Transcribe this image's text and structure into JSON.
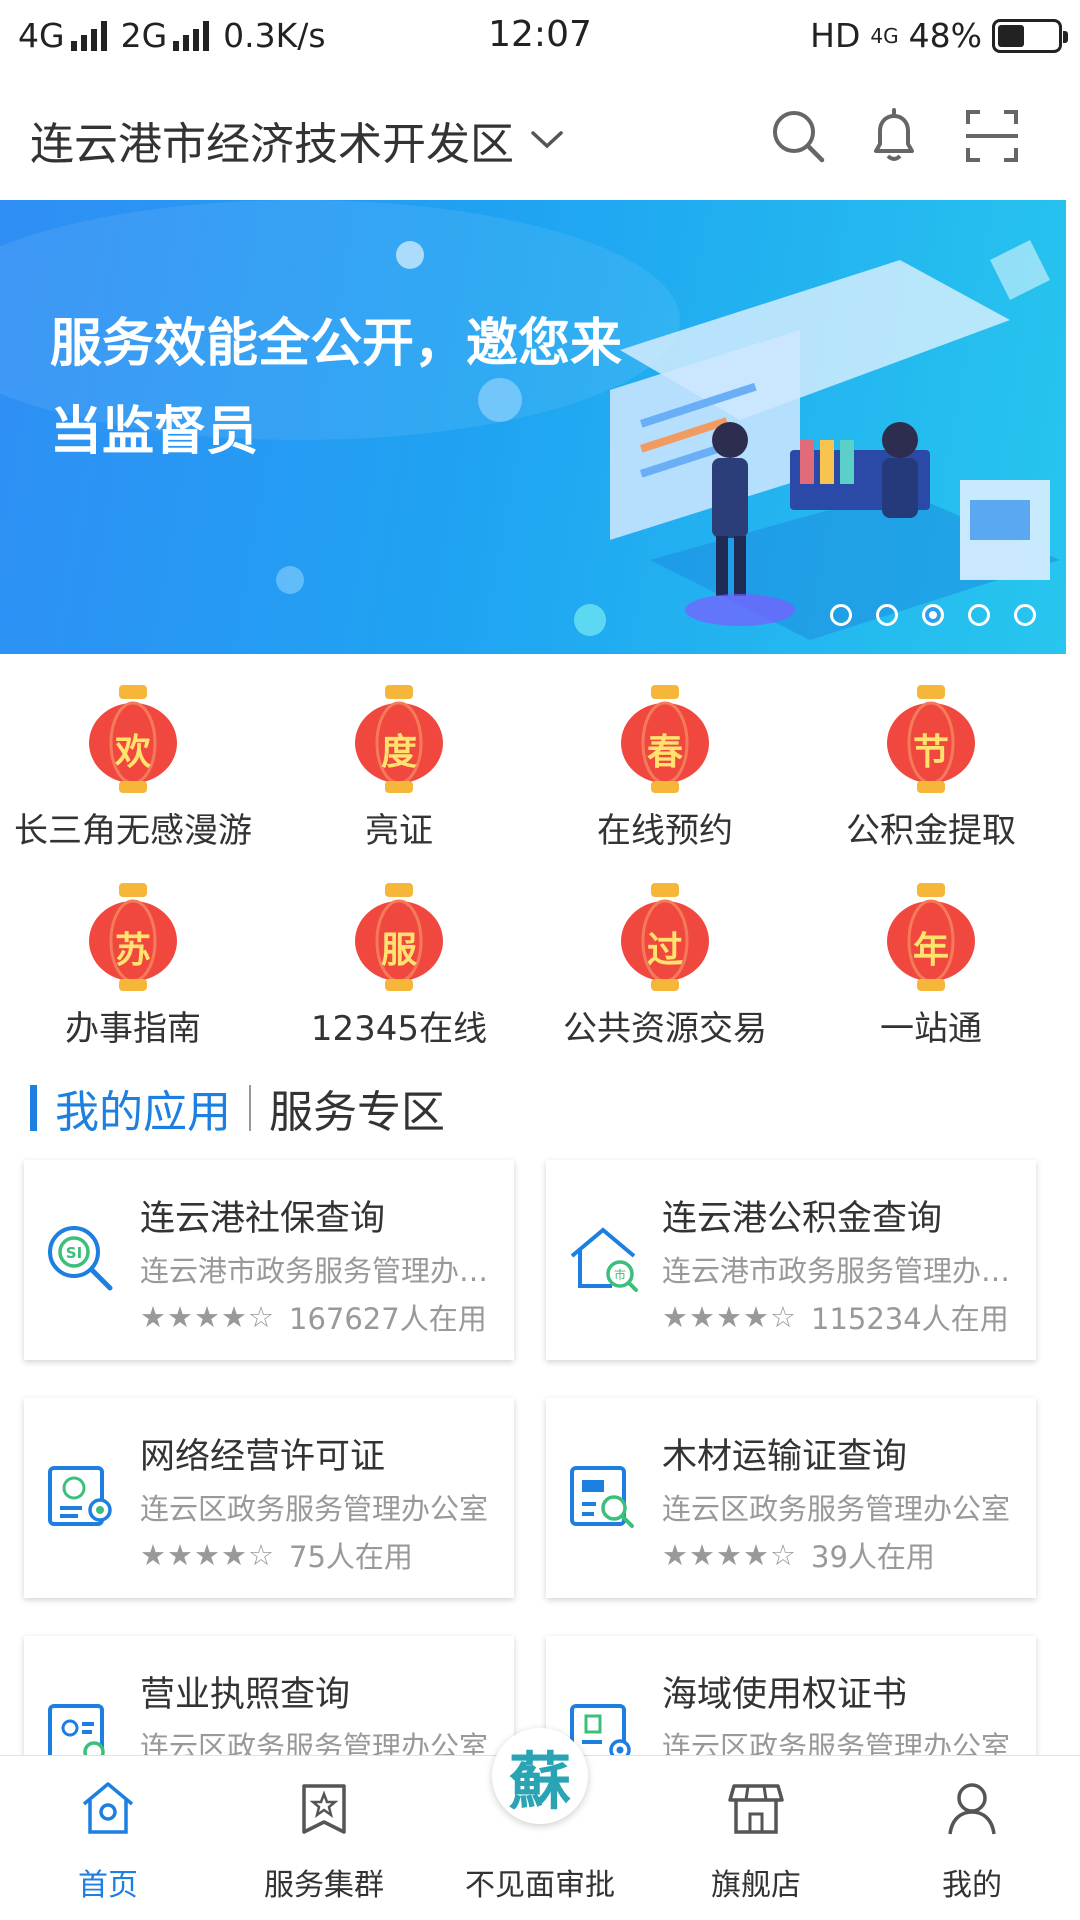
{
  "status_bar": {
    "network1": "4G",
    "network2": "2G",
    "speed": "0.3K/s",
    "time": "12:07",
    "hd": "HD",
    "volte": "4G",
    "battery": "48%"
  },
  "header": {
    "region": "连云港市经济技术开发区"
  },
  "banner": {
    "line1": "服务效能全公开，邀您来",
    "line2": "当监督员",
    "slide_count": 5,
    "active_slide": 3
  },
  "quick_grid": [
    {
      "badge": "欢",
      "label": "长三角无感漫游"
    },
    {
      "badge": "度",
      "label": "亮证"
    },
    {
      "badge": "春",
      "label": "在线预约"
    },
    {
      "badge": "节",
      "label": "公积金提取"
    },
    {
      "badge": "苏",
      "label": "办事指南"
    },
    {
      "badge": "服",
      "label": "12345在线"
    },
    {
      "badge": "过",
      "label": "公共资源交易"
    },
    {
      "badge": "年",
      "label": "一站通"
    }
  ],
  "section": {
    "tab_active": "我的应用",
    "tab_other": "服务专区"
  },
  "apps": [
    {
      "title": "连云港社保查询",
      "org": "连云港市政务服务管理办公室",
      "stars": "★★★★☆",
      "users": "167627人在用",
      "icon": "social-security-search-icon"
    },
    {
      "title": "连云港公积金查询",
      "org": "连云港市政务服务管理办公室",
      "stars": "★★★★☆",
      "users": "115234人在用",
      "icon": "housing-fund-icon"
    },
    {
      "title": "网络经营许可证",
      "org": "连云区政务服务管理办公室",
      "stars": "★★★★☆",
      "users": "75人在用",
      "icon": "certificate-icon"
    },
    {
      "title": "木材运输证查询",
      "org": "连云区政务服务管理办公室",
      "stars": "★★★★☆",
      "users": "39人在用",
      "icon": "transport-certificate-icon"
    },
    {
      "title": "营业执照查询",
      "org": "连云区政务服务管理办公室",
      "stars": "",
      "users": "",
      "icon": "business-license-icon"
    },
    {
      "title": "海域使用权证书",
      "org": "连云区政务服务管理办公室",
      "stars": "",
      "users": "",
      "icon": "sea-area-certificate-icon"
    }
  ],
  "bottom_nav": [
    {
      "label": "首页",
      "icon": "home-icon",
      "active": true
    },
    {
      "label": "服务集群",
      "icon": "service-cluster-icon",
      "active": false
    },
    {
      "label": "不见面审批",
      "icon": "su-logo-icon",
      "active": false
    },
    {
      "label": "旗舰店",
      "icon": "store-icon",
      "active": false
    },
    {
      "label": "我的",
      "icon": "user-icon",
      "active": false
    }
  ],
  "center_logo_char": "蘇",
  "colors": {
    "accent": "#1d7fe0",
    "lantern": "#f0483e",
    "lantern_cap": "#f5b63a"
  }
}
